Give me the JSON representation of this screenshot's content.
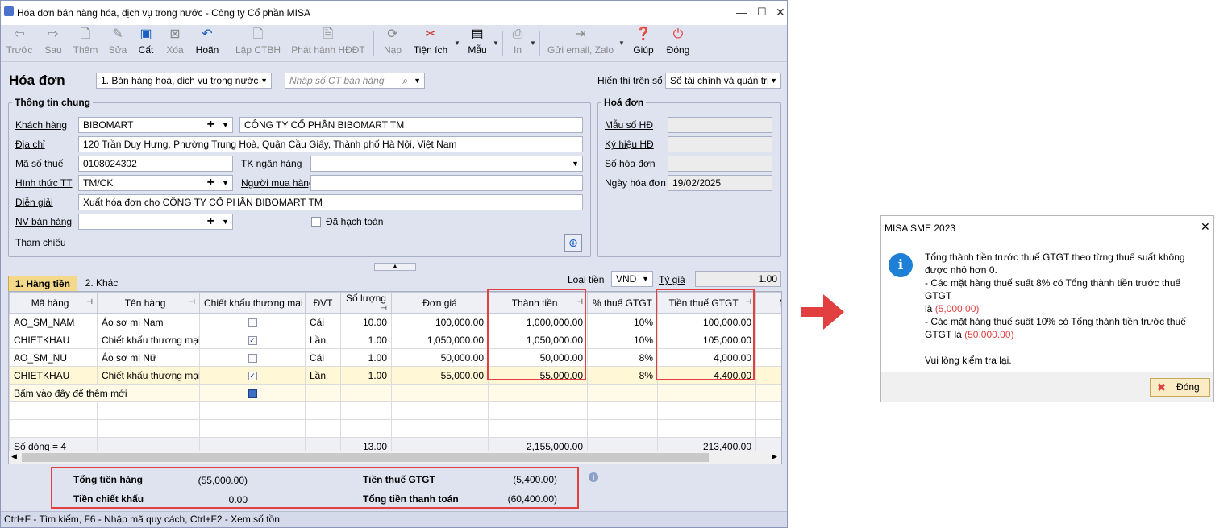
{
  "window": {
    "title": "Hóa đơn bán hàng hóa, dịch vụ trong nước - Công ty Cổ phần MISA"
  },
  "toolbar": {
    "prev": "Trước",
    "next": "Sau",
    "add": "Thêm",
    "edit": "Sửa",
    "save": "Cất",
    "delete": "Xóa",
    "undo": "Hoãn",
    "create_ctbh": "Lập CTBH",
    "issue_hddt": "Phát hành HĐĐT",
    "load": "Nạp",
    "utilities": "Tiện ích",
    "template": "Mẫu",
    "print": "In",
    "send": "Gửi email, Zalo",
    "help": "Giúp",
    "close": "Đóng"
  },
  "header": {
    "title": "Hóa đơn",
    "invoice_type": "1. Bán hàng hoá, dịch vụ trong nước",
    "search_placeholder": "Nhập số CT bán hàng",
    "display_label": "Hiển thị trên sổ",
    "display_value": "Sổ tài chính và quản trị"
  },
  "general": {
    "group_title": "Thông tin chung",
    "customer_label": "Khách hàng",
    "customer_code": "BIBOMART",
    "customer_name": "CÔNG TY CỔ PHẦN BIBOMART TM",
    "address_label": "Địa chỉ",
    "address": "120 Trần Duy Hưng, Phường Trung Hoà, Quận Cầu Giấy, Thành phố Hà Nội, Việt Nam",
    "tax_label": "Mã số thuế",
    "tax_code": "0108024302",
    "bank_label": "TK ngân hàng",
    "bank_value": "",
    "payment_label": "Hình thức TT",
    "payment_value": "TM/CK",
    "buyer_label": "Người mua hàng",
    "buyer_value": "",
    "desc_label": "Diễn giải",
    "desc_value": "Xuất hóa đơn cho CÔNG TY CỔ PHẦN BIBOMART TM",
    "staff_label": "NV bán hàng",
    "staff_value": "",
    "posted_label": "Đã hạch toán",
    "ref_label": "Tham chiếu"
  },
  "invoice": {
    "group_title": "Hoá đơn",
    "form_label": "Mẫu số HĐ",
    "form_value": "",
    "symbol_label": "Ký hiệu HĐ",
    "symbol_value": "",
    "number_label": "Số hóa đơn",
    "number_value": "",
    "date_label": "Ngày hóa đơn",
    "date_value": "19/02/2025"
  },
  "tabs": {
    "goods": "1. Hàng tiền",
    "other": "2. Khác"
  },
  "currency": {
    "label": "Loại tiền",
    "value": "VND",
    "rate_label": "Tỷ giá",
    "rate_value": "1.00"
  },
  "grid": {
    "headers": [
      "Mã hàng",
      "Tên hàng",
      "Chiết khấu thương mại",
      "ĐVT",
      "Số lượng",
      "Đơn giá",
      "Thành tiền",
      "% thuế GTGT",
      "Tiền thuế GTGT",
      "Mã"
    ],
    "rows": [
      {
        "code": "AO_SM_NAM",
        "name": "Áo sơ mi Nam",
        "discount": false,
        "unit": "Cái",
        "qty": "10.00",
        "price": "100,000.00",
        "amount": "1,000,000.00",
        "vat_rate": "10%",
        "vat": "100,000.00"
      },
      {
        "code": "CHIETKHAU",
        "name": "Chiết khấu thương mại",
        "discount": true,
        "unit": "Lần",
        "qty": "1.00",
        "price": "1,050,000.00",
        "amount": "1,050,000.00",
        "vat_rate": "10%",
        "vat": "105,000.00"
      },
      {
        "code": "AO_SM_NU",
        "name": "Áo sơ mi Nữ",
        "discount": false,
        "unit": "Cái",
        "qty": "1.00",
        "price": "50,000.00",
        "amount": "50,000.00",
        "vat_rate": "8%",
        "vat": "4,000.00"
      },
      {
        "code": "CHIETKHAU",
        "name": "Chiết khấu thương mại",
        "discount": true,
        "unit": "Lần",
        "qty": "1.00",
        "price": "55,000.00",
        "amount": "55,000.00",
        "vat_rate": "8%",
        "vat": "4,400.00"
      }
    ],
    "new_row_hint": "Bấm vào đây để thêm mới",
    "footer": {
      "row_count": "Số dòng = 4",
      "qty_total": "13.00",
      "amount_total": "2,155,000.00",
      "vat_total": "213,400.00"
    }
  },
  "totals": {
    "goods_label": "Tổng tiền hàng",
    "goods_value": "(55,000.00)",
    "discount_label": "Tiền chiết khấu",
    "discount_value": "0.00",
    "vat_label": "Tiền thuế GTGT",
    "vat_value": "(5,400.00)",
    "pay_label": "Tổng tiền thanh toán",
    "pay_value": "(60,400.00)"
  },
  "statusbar": "Ctrl+F - Tìm kiếm, F6 - Nhập mã quy cách, Ctrl+F2 - Xem số tồn",
  "dialog": {
    "title": "MISA SME 2023",
    "line1": "Tổng thành tiền trước thuế GTGT theo từng thuế suất không",
    "line2": "được nhỏ hơn 0.",
    "line3": "- Các mặt hàng thuế suất 8% có Tổng thành tiền trước thuế GTGT",
    "line4_pre": "là ",
    "line4_val": "(5,000.00)",
    "line5": "- Các mặt hàng thuế suất 10% có Tổng thành tiền trước thuế",
    "line6_pre": "GTGT là ",
    "line6_val": "(50,000.00)",
    "line7": "Vui lòng kiểm tra lại.",
    "close_button": "Đóng"
  },
  "colors": {
    "accent_red": "#e24040",
    "info_blue": "#1e7fd6",
    "window_bg": "#dfe3f0"
  }
}
